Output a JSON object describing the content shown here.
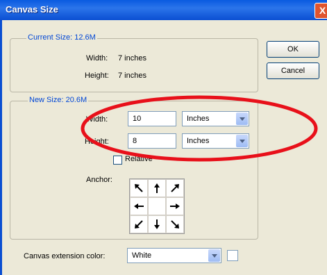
{
  "window": {
    "title": "Canvas Size",
    "close_glyph": "X"
  },
  "buttons": {
    "ok": "OK",
    "cancel": "Cancel"
  },
  "current_size": {
    "legend": "Current Size: 12.6M",
    "width_label": "Width:",
    "width_value": "7 inches",
    "height_label": "Height:",
    "height_value": "7 inches"
  },
  "new_size": {
    "legend": "New Size: 20.6M",
    "width_label": "Width:",
    "width_value": "10",
    "width_unit": "Inches",
    "height_label": "Height:",
    "height_value": "8",
    "height_unit": "Inches",
    "relative_label": "Relative",
    "relative_checked": false,
    "anchor_label": "Anchor:"
  },
  "anchor": {
    "cells": [
      "arrow-nw-icon",
      "arrow-n-icon",
      "arrow-ne-icon",
      "arrow-w-icon",
      "anchor-center",
      "arrow-e-icon",
      "arrow-sw-icon",
      "arrow-s-icon",
      "arrow-se-icon"
    ]
  },
  "extension": {
    "label": "Canvas extension color:",
    "value": "White",
    "swatch_color": "#ffffff"
  },
  "annotation": {
    "ellipse_color": "#e8101a"
  }
}
